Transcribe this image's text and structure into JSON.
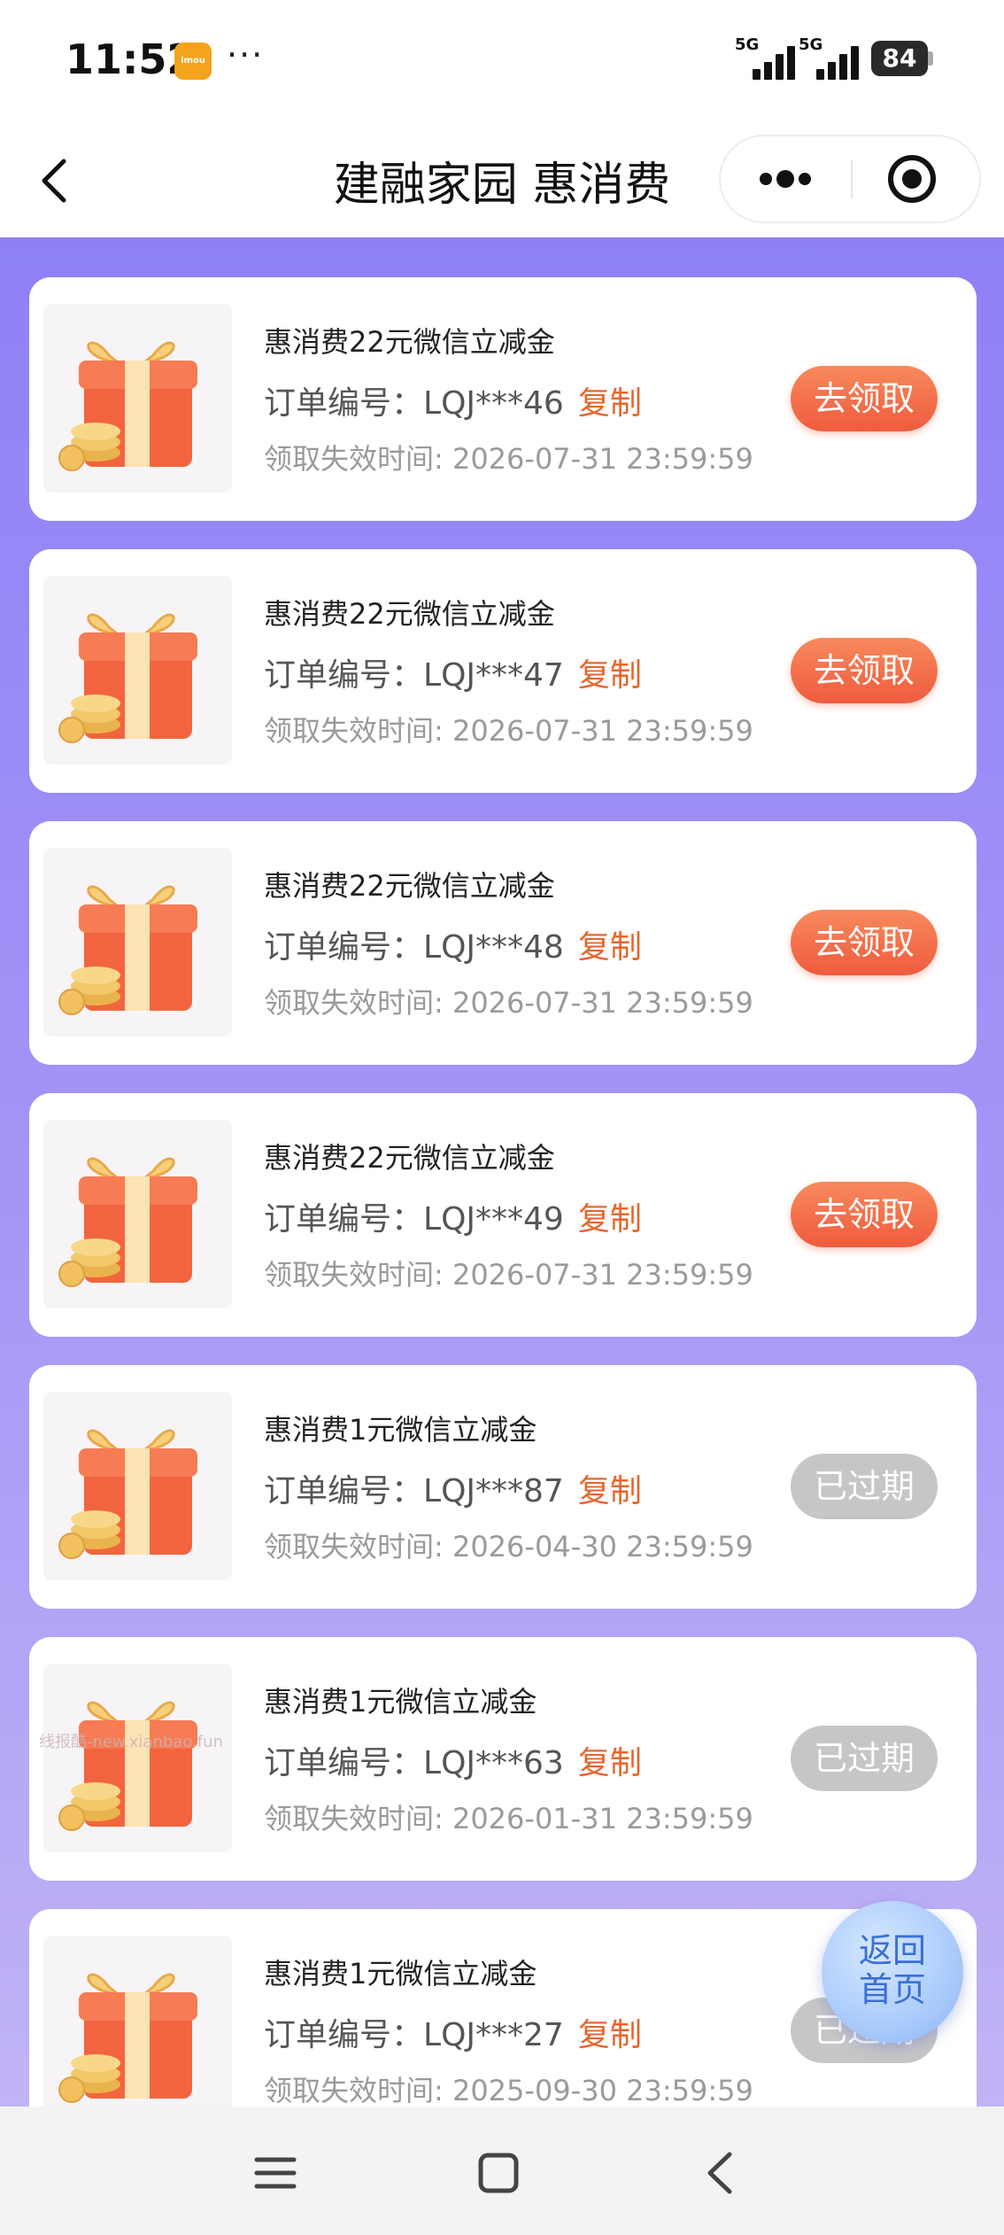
{
  "status_bar": {
    "time": "11:52",
    "app_icon_label": "imou",
    "more": "···",
    "signal_1_label": "5G",
    "signal_2_label": "5G",
    "battery": "84"
  },
  "header": {
    "title": "建融家园 惠消费"
  },
  "cards": [
    {
      "title": "惠消费22元微信立减金",
      "order_label": "订单编号：",
      "order_no": "LQJ***46",
      "copy": "复制",
      "expire": "领取失效时间: 2026-07-31 23:59:59",
      "button": "去领取",
      "status": "active"
    },
    {
      "title": "惠消费22元微信立减金",
      "order_label": "订单编号：",
      "order_no": "LQJ***47",
      "copy": "复制",
      "expire": "领取失效时间: 2026-07-31 23:59:59",
      "button": "去领取",
      "status": "active"
    },
    {
      "title": "惠消费22元微信立减金",
      "order_label": "订单编号：",
      "order_no": "LQJ***48",
      "copy": "复制",
      "expire": "领取失效时间: 2026-07-31 23:59:59",
      "button": "去领取",
      "status": "active"
    },
    {
      "title": "惠消费22元微信立减金",
      "order_label": "订单编号：",
      "order_no": "LQJ***49",
      "copy": "复制",
      "expire": "领取失效时间: 2026-07-31 23:59:59",
      "button": "去领取",
      "status": "active"
    },
    {
      "title": "惠消费1元微信立减金",
      "order_label": "订单编号：",
      "order_no": "LQJ***87",
      "copy": "复制",
      "expire": "领取失效时间: 2026-04-30 23:59:59",
      "button": "已过期",
      "status": "expired"
    },
    {
      "title": "惠消费1元微信立减金",
      "order_label": "订单编号：",
      "order_no": "LQJ***63",
      "copy": "复制",
      "expire": "领取失效时间: 2026-01-31 23:59:59",
      "button": "已过期",
      "status": "expired"
    },
    {
      "title": "惠消费1元微信立减金",
      "order_label": "订单编号：",
      "order_no": "LQJ***27",
      "copy": "复制",
      "expire": "领取失效时间: 2025-09-30 23:59:59",
      "button": "已过期",
      "status": "expired"
    }
  ],
  "watermark": "线报酷-new.xianbao.fun",
  "float_button": {
    "line1": "返回",
    "line2": "首页"
  },
  "icons": {
    "back": "chevron-left-icon",
    "more": "more-dots-icon",
    "close": "target-close-icon",
    "gift": "gift-box-icon",
    "nav_menu": "menu-icon",
    "nav_home": "square-home-icon",
    "nav_back": "chevron-back-icon"
  },
  "colors": {
    "accent_orange": "#ef5b3e",
    "copy_orange": "#e8652a",
    "background_purple": "#8e81f7",
    "expired_gray": "#c6c6c6"
  }
}
